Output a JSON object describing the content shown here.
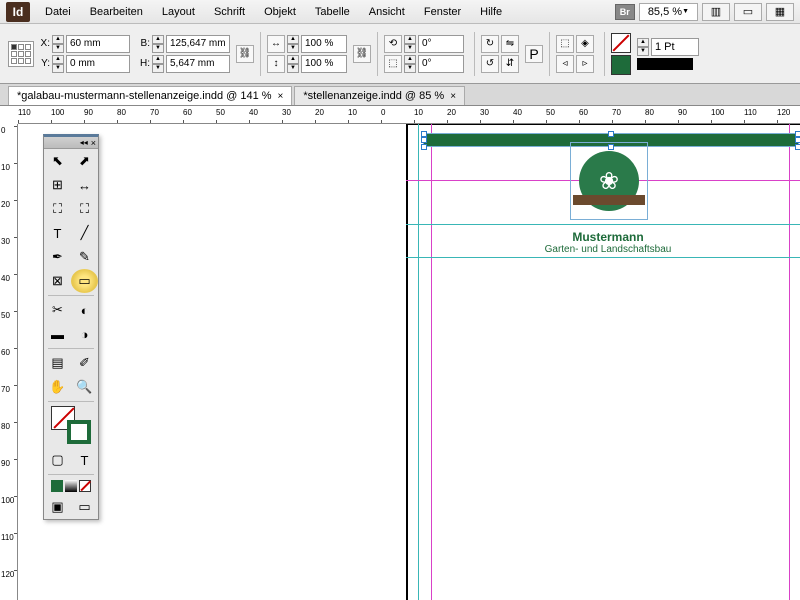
{
  "menu": {
    "items": [
      "Datei",
      "Bearbeiten",
      "Layout",
      "Schrift",
      "Objekt",
      "Tabelle",
      "Ansicht",
      "Fenster",
      "Hilfe"
    ],
    "br": "Br",
    "zoom": "85,5 %"
  },
  "control": {
    "x": "60 mm",
    "y": "0 mm",
    "w": "125,647 mm",
    "h": "5,647 mm",
    "scale_x": "100 %",
    "scale_y": "100 %",
    "rotate": "0°",
    "shear": "0°",
    "stroke_weight": "1 Pt"
  },
  "tabs": [
    {
      "label": "*galabau-mustermann-stellenanzeige.indd @ 141 %",
      "active": true
    },
    {
      "label": "*stellenanzeige.indd @ 85 %",
      "active": false
    }
  ],
  "ruler_h": [
    110,
    100,
    90,
    80,
    70,
    60,
    50,
    40,
    30,
    20,
    10,
    0,
    10,
    20,
    30,
    40,
    50,
    60,
    70,
    80,
    90,
    100,
    110,
    120
  ],
  "ruler_v": [
    0,
    10,
    20,
    30,
    40,
    50,
    60,
    70,
    80,
    90,
    100,
    110,
    120
  ],
  "doc": {
    "company": "Mustermann",
    "subtitle": "Garten- und Landschaftsbau"
  }
}
